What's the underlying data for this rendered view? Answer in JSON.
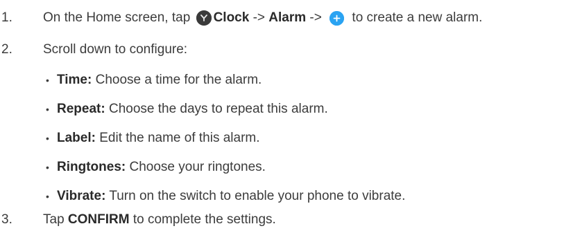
{
  "steps": [
    {
      "number": "1.",
      "pre": "On the Home screen, tap ",
      "app": "Clock",
      "arrow1": " -> ",
      "menu": "Alarm",
      "arrow2": " -> ",
      "post": " to create a new alarm."
    },
    {
      "number": "2.",
      "text": "Scroll down to configure:"
    },
    {
      "number": "3.",
      "pre": "Tap ",
      "action": "CONFIRM",
      "post": " to complete the settings."
    }
  ],
  "options": [
    {
      "term": "Time:",
      "desc": " Choose a time for the alarm."
    },
    {
      "term": "Repeat:",
      "desc": " Choose the days to repeat this alarm."
    },
    {
      "term": "Label:",
      "desc": " Edit the name of this alarm."
    },
    {
      "term": "Ringtones:",
      "desc": " Choose your ringtones."
    },
    {
      "term": "Vibrate:",
      "desc": " Turn on the switch to enable your phone to vibrate."
    }
  ],
  "bullet_char": "•",
  "icons": {
    "clock": "clock-app-icon",
    "add": "add-plus-icon"
  },
  "colors": {
    "text": "#3c3c3c",
    "add_icon": "#2aa3f2",
    "clock_icon": "#3a3a3a"
  }
}
